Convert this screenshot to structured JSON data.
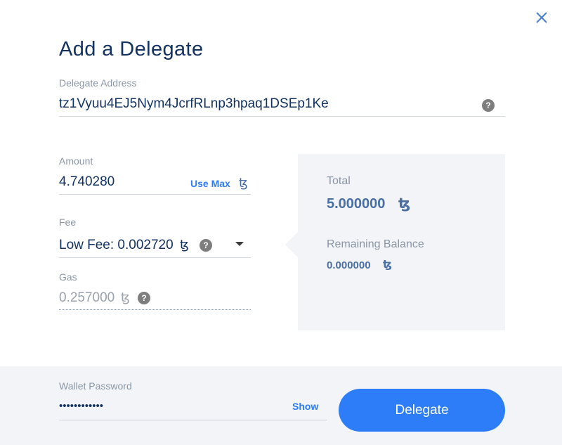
{
  "dialog": {
    "title": "Add a Delegate",
    "close_icon": "close-icon"
  },
  "delegate_address": {
    "label": "Delegate Address",
    "value": "tz1Vyuu4EJ5Nym4JcrfRLnp3hpaq1DSEp1Ke",
    "help": "?"
  },
  "amount": {
    "label": "Amount",
    "value": "4.740280",
    "use_max": "Use Max",
    "currency_symbol": "ꜩ"
  },
  "fee": {
    "label": "Fee",
    "value": "Low Fee: 0.002720",
    "currency_symbol": "ꜩ",
    "help": "?"
  },
  "gas": {
    "label": "Gas",
    "value": "0.257000",
    "currency_symbol": "ꜩ",
    "help": "?"
  },
  "summary": {
    "total_label": "Total",
    "total_value": "5.000000",
    "remaining_label": "Remaining Balance",
    "remaining_value": "0.000000",
    "currency_symbol": "ꜩ"
  },
  "footer": {
    "password_label": "Wallet Password",
    "password_value": "••••••••••••",
    "show_label": "Show",
    "delegate_label": "Delegate"
  },
  "colors": {
    "accent": "#2c7df7",
    "title": "#123262",
    "summary_value": "#4a6fa5",
    "panel_bg": "#f2f4f7"
  }
}
